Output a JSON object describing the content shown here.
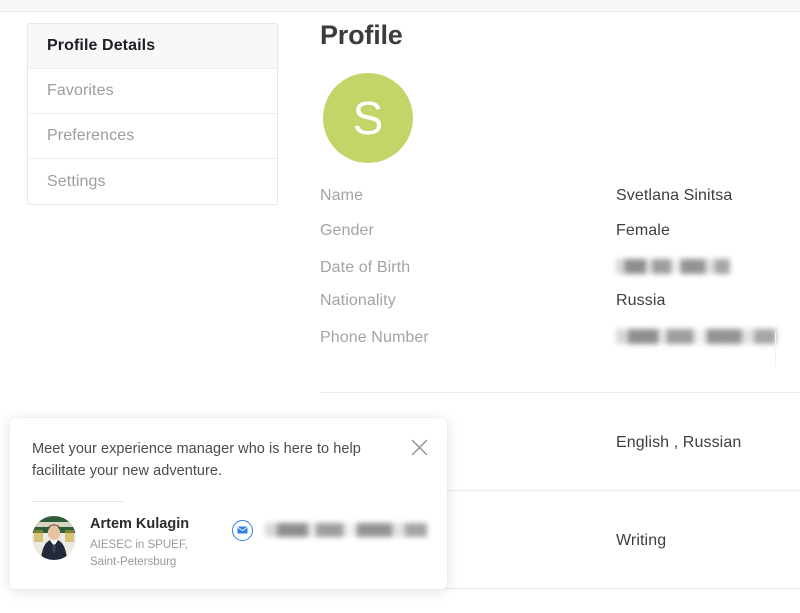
{
  "sidebar": {
    "items": [
      {
        "label": "Profile Details",
        "active": true
      },
      {
        "label": "Favorites",
        "active": false
      },
      {
        "label": "Preferences",
        "active": false
      },
      {
        "label": "Settings",
        "active": false
      }
    ]
  },
  "main": {
    "title": "Profile",
    "avatar_initial": "S",
    "avatar_color": "#c5d469",
    "fields": [
      {
        "label": "Name",
        "value": "Svetlana Sinitsa",
        "redacted": false
      },
      {
        "label": "Gender",
        "value": "Female",
        "redacted": false
      },
      {
        "label": "Date of Birth",
        "value": "",
        "redacted": true
      },
      {
        "label": "Nationality",
        "value": "Russia",
        "redacted": false
      },
      {
        "label": "Phone Number",
        "value": "",
        "redacted": true
      }
    ],
    "lower_fields": [
      {
        "label": "",
        "value": "English , Russian",
        "redacted": false
      },
      {
        "label": "",
        "value": "Writing",
        "redacted": false
      }
    ]
  },
  "popup": {
    "message": "Meet your experience manager who is here to help facilitate your new adventure.",
    "close_icon": "close-icon",
    "manager": {
      "name": "Artem Kulagin",
      "organization": "AIESEC in SPUEF, Saint-Petersburg",
      "email": "",
      "email_redacted": true,
      "mail_icon": "envelope-icon",
      "accent_color": "#2f7fe8"
    }
  }
}
